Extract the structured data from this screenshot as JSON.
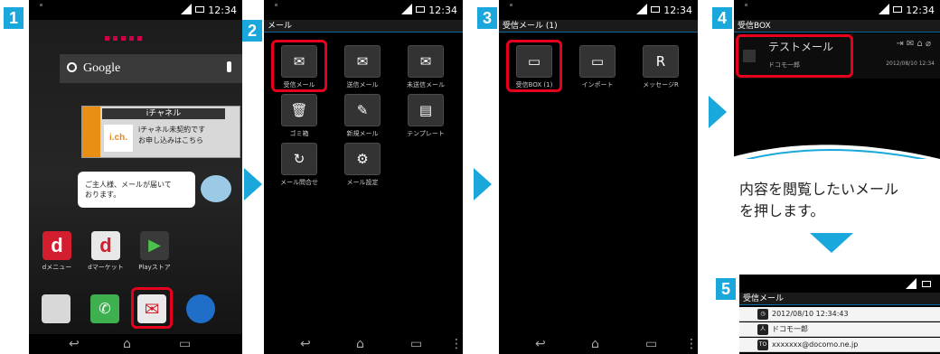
{
  "status": {
    "time": "12:34"
  },
  "steps": [
    "1",
    "2",
    "3",
    "4",
    "5"
  ],
  "screen1": {
    "search_text": "Google",
    "ichannel_title": "iチャネル",
    "ichannel_logo": "i.ch.",
    "ichannel_msg1": "iチャネル未契約です",
    "ichannel_msg2": "お申し込みはこちら",
    "bubble_line1": "ご主人様、メールが届いて",
    "bubble_line2": "おります。",
    "apps": [
      {
        "label": "dメニュー",
        "color": "#d21e2e"
      },
      {
        "label": "dマーケット",
        "color": "#e8e8e8"
      },
      {
        "label": "Playストア",
        "color": "#3a3a3a"
      }
    ]
  },
  "screen2": {
    "title": "メール",
    "items": [
      {
        "label": "受信メール",
        "icon": "✉"
      },
      {
        "label": "送信メール",
        "icon": "✉"
      },
      {
        "label": "未送信メール",
        "icon": "✉"
      },
      {
        "label": "ゴミ箱",
        "icon": "🗑"
      },
      {
        "label": "新規メール",
        "icon": "✎"
      },
      {
        "label": "テンプレート",
        "icon": "▤"
      },
      {
        "label": "メール問合せ",
        "icon": "↻"
      },
      {
        "label": "メール設定",
        "icon": "⚙"
      }
    ]
  },
  "screen3": {
    "title": "受信メール (1)",
    "items": [
      {
        "label": "受信BOX (1)",
        "icon": "▭"
      },
      {
        "label": "インポート",
        "icon": "▭"
      },
      {
        "label": "メッセージR",
        "icon": "R"
      }
    ]
  },
  "screen4": {
    "title": "受信BOX",
    "subject": "テストメール",
    "from": "ドコモ一郎",
    "date": "2012/08/10 12:34",
    "icons": "⇥ ✉ ⌂ ⌀"
  },
  "caption": {
    "line1": "内容を閲覧したいメール",
    "line2": "を押します。"
  },
  "screen5": {
    "title": "受信メール",
    "rows": [
      {
        "icon": "◷",
        "text": "2012/08/10 12:34:43"
      },
      {
        "icon": "人",
        "text": "ドコモ一郎"
      },
      {
        "icon": "TO",
        "text": "xxxxxxx@docomo.ne.jp"
      }
    ]
  }
}
